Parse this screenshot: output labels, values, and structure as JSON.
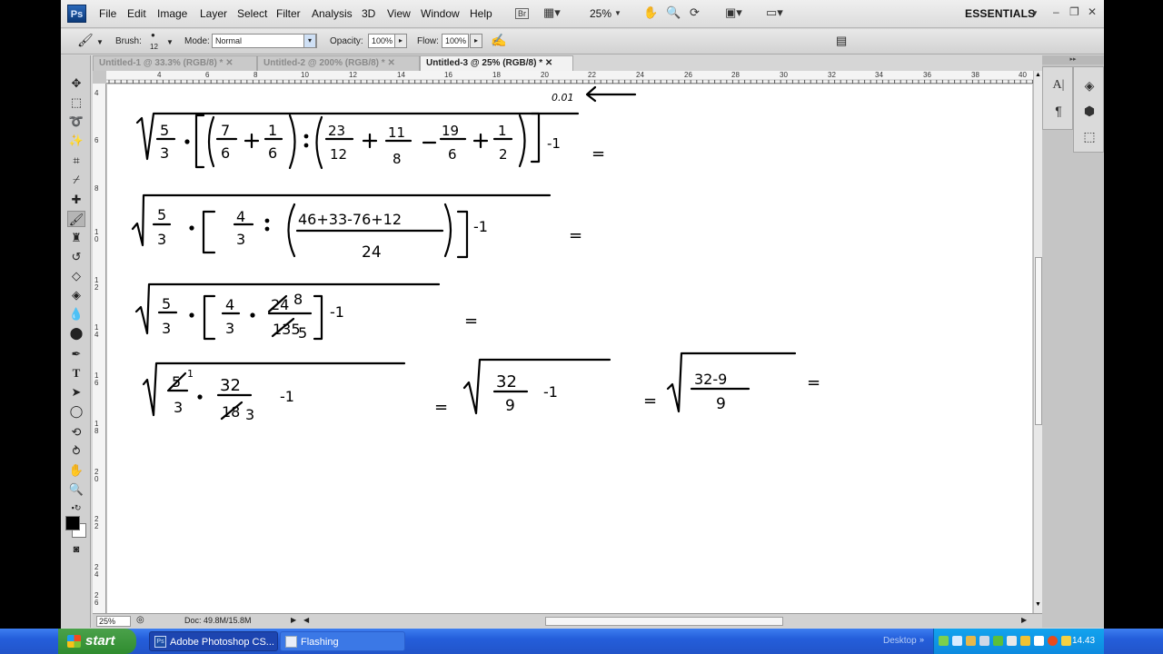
{
  "menu": {
    "logo": "Ps",
    "items": [
      "File",
      "Edit",
      "Image",
      "Layer",
      "Select",
      "Filter",
      "Analysis",
      "3D",
      "View",
      "Window",
      "Help"
    ],
    "bridge_label": "Br",
    "zoom": "25%",
    "workspace": "ESSENTIALS"
  },
  "options": {
    "brush_label": "Brush:",
    "brush_size": "12",
    "mode_label": "Mode:",
    "mode_value": "Normal",
    "opacity_label": "Opacity:",
    "opacity_value": "100%",
    "flow_label": "Flow:",
    "flow_value": "100%"
  },
  "tabs": [
    {
      "label": "Untitled-1 @ 33.3% (RGB/8) *",
      "active": false
    },
    {
      "label": "Untitled-2 @ 200% (RGB/8) *",
      "active": false
    },
    {
      "label": "Untitled-3 @ 25% (RGB/8) *",
      "active": true
    }
  ],
  "ruler": {
    "top_ticks": [
      "4",
      "6",
      "8",
      "10",
      "12",
      "14",
      "16",
      "18",
      "20",
      "22",
      "24",
      "26",
      "28",
      "30",
      "32",
      "34",
      "36",
      "38",
      "40"
    ],
    "left_ticks": [
      "4",
      "6",
      "8",
      "1\n0",
      "1\n2",
      "1\n4",
      "1\n6",
      "1\n8",
      "2\n0",
      "2\n2",
      "2\n4",
      "2\n6"
    ]
  },
  "handwriting": {
    "corner_note": "0.01",
    "line1": [
      "5",
      "3",
      "7",
      "6",
      "1",
      "6",
      "23",
      "12",
      "11",
      "8",
      "19",
      "6",
      "1",
      "2",
      "-1",
      "="
    ],
    "line2": [
      "5",
      "3",
      "4",
      "3",
      "46+33-76+12",
      "24",
      "-1",
      "="
    ],
    "line3": [
      "5",
      "3",
      "4",
      "3",
      "24",
      "8",
      "135",
      "5",
      "-1",
      "="
    ],
    "line4": [
      "5",
      "1",
      "3",
      "32",
      "18",
      "3",
      "-1",
      "=",
      "32",
      "9",
      "-1",
      "=",
      "32-9",
      "9",
      "="
    ]
  },
  "status": {
    "zoom": "25%",
    "doc": "Doc: 49.8M/15.8M"
  },
  "taskbar": {
    "start": "start",
    "items": [
      {
        "label": "Adobe Photoshop CS...",
        "icon": "Ps",
        "active": true
      },
      {
        "label": "Flashing",
        "icon": "",
        "active": false
      }
    ],
    "desktop": "Desktop",
    "clock": "14.43"
  }
}
